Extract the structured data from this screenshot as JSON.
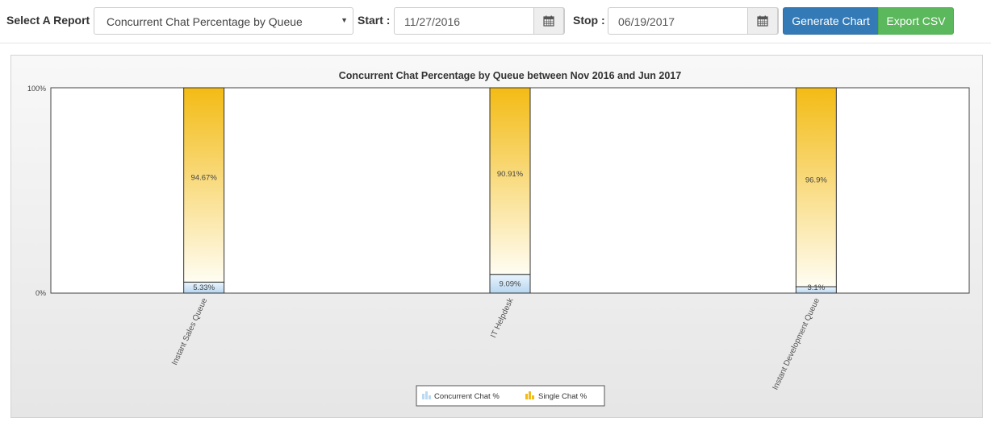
{
  "toolbar": {
    "report_label": "Select A Report",
    "report_value": "Concurrent Chat Percentage by Queue",
    "start_label": "Start :",
    "start_value": "11/27/2016",
    "stop_label": "Stop :",
    "stop_value": "06/19/2017",
    "generate_label": "Generate Chart",
    "export_label": "Export CSV",
    "caret_icon": "chevron-down-icon",
    "calendar_icon": "calendar-icon"
  },
  "colors": {
    "generate": "#337ab7",
    "export": "#5cb85c",
    "concurrent": "#bcd9f2",
    "single": "#f3bb14"
  },
  "chart_data": {
    "type": "bar",
    "stacked": true,
    "title": "Concurrent Chat Percentage by Queue between Nov 2016 and Jun 2017",
    "categories": [
      "Instant Sales Queue",
      "IT Helpdesk",
      "Instant Development Queue"
    ],
    "series": [
      {
        "name": "Concurrent Chat %",
        "values": [
          5.33,
          9.09,
          3.1
        ],
        "labels": [
          "5.33%",
          "9.09%",
          "3.1%"
        ]
      },
      {
        "name": "Single Chat %",
        "values": [
          94.67,
          90.91,
          96.9
        ],
        "labels": [
          "94.67%",
          "90.91%",
          "96.9%"
        ]
      }
    ],
    "y_ticks": [
      "0%",
      "100%"
    ],
    "ylim": [
      0,
      100
    ],
    "legend": "bottom-center",
    "grid": false
  }
}
